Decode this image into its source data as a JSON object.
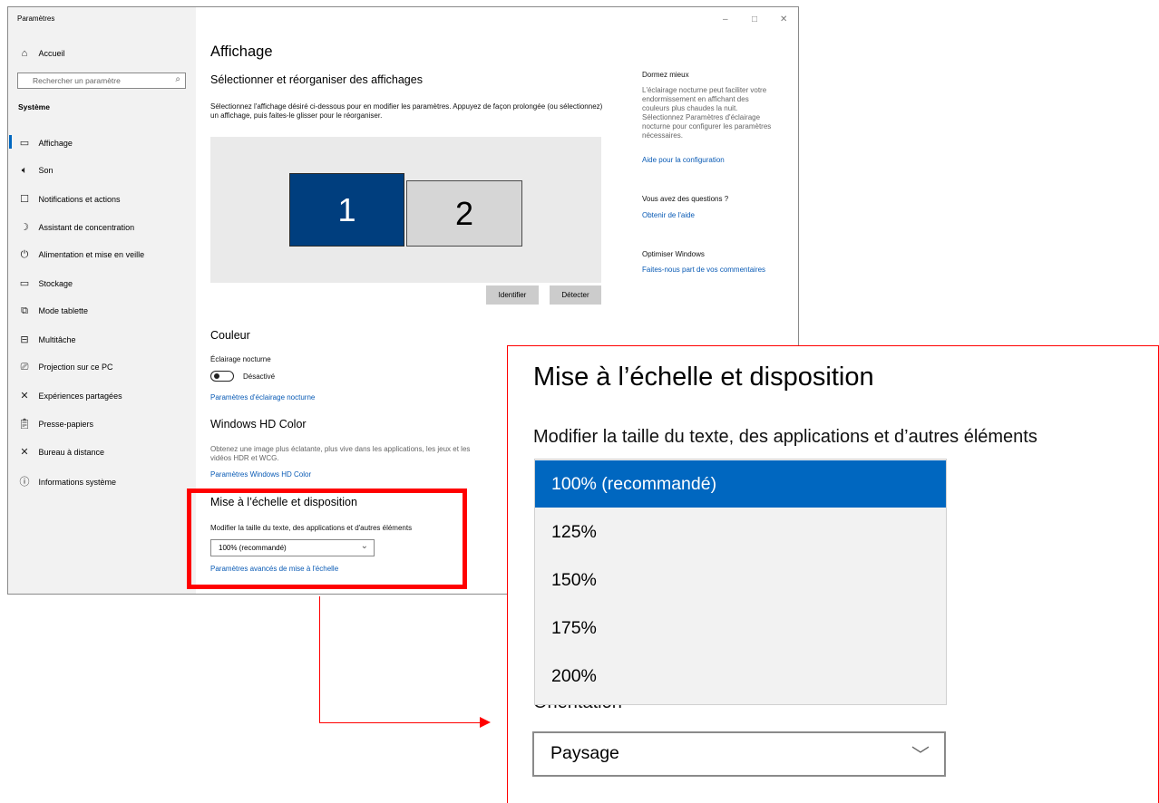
{
  "window": {
    "title": "Paramètres",
    "controls": [
      "–",
      "□",
      "✕"
    ]
  },
  "sidebar": {
    "home": "Accueil",
    "search_placeholder": "Rechercher un paramètre",
    "section": "Système",
    "items": [
      {
        "label": "Affichage",
        "icon": "monitor-icon"
      },
      {
        "label": "Son",
        "icon": "speaker-icon"
      },
      {
        "label": "Notifications et actions",
        "icon": "notification-icon"
      },
      {
        "label": "Assistant de concentration",
        "icon": "moon-icon"
      },
      {
        "label": "Alimentation et mise en veille",
        "icon": "power-icon"
      },
      {
        "label": "Stockage",
        "icon": "storage-icon"
      },
      {
        "label": "Mode tablette",
        "icon": "tablet-icon"
      },
      {
        "label": "Multitâche",
        "icon": "multitask-icon"
      },
      {
        "label": "Projection sur ce PC",
        "icon": "projection-icon"
      },
      {
        "label": "Expériences partagées",
        "icon": "shared-icon"
      },
      {
        "label": "Presse-papiers",
        "icon": "clipboard-icon"
      },
      {
        "label": "Bureau à distance",
        "icon": "remote-desktop-icon"
      },
      {
        "label": "Informations système",
        "icon": "info-icon"
      }
    ]
  },
  "main": {
    "title": "Affichage",
    "arrange_heading": "Sélectionner et réorganiser des affichages",
    "arrange_desc": "Sélectionnez l'affichage désiré ci-dessous pour en modifier les paramètres. Appuyez de façon prolongée (ou sélectionnez) un affichage, puis faites-le glisser pour le réorganiser.",
    "monitors": [
      "1",
      "2"
    ],
    "identify": "Identifier",
    "detect": "Détecter",
    "color_heading": "Couleur",
    "night_light_label": "Éclairage nocturne",
    "night_light_state": "Désactivé",
    "night_light_link": "Paramètres d'éclairage nocturne",
    "hdr_heading": "Windows HD Color",
    "hdr_desc": "Obtenez une image plus éclatante, plus vive dans les applications, les jeux et les vidéos HDR et WCG.",
    "hdr_link": "Paramètres Windows HD Color",
    "scale_heading": "Mise à l’échelle et disposition",
    "scale_label": "Modifier la taille du texte, des applications et d'autres éléments",
    "scale_value": "100% (recommandé)",
    "scale_link": "Paramètres avancés de mise à l'échelle"
  },
  "aside": {
    "sleep_heading": "Dormez mieux",
    "sleep_text": "L'éclairage nocturne peut faciliter votre endormissement en affichant des couleurs plus chaudes la nuit. Sélectionnez Paramètres d'éclairage nocturne pour configurer les paramètres nécessaires.",
    "sleep_link": "Aide pour la configuration",
    "questions_heading": "Vous avez des questions ?",
    "questions_link": "Obtenir de l'aide",
    "optimize_heading": "Optimiser Windows",
    "optimize_link": "Faites-nous part de vos commentaires"
  },
  "zoom": {
    "heading": "Mise à l’échelle et disposition",
    "label": "Modifier la taille du texte, des applications et d’autres éléments",
    "options": [
      "100% (recommandé)",
      "125%",
      "150%",
      "175%",
      "200%"
    ],
    "selected_index": 0,
    "orientation_label": "Orientation",
    "orientation_value": "Paysage"
  },
  "colors": {
    "accent": "#0067c0",
    "monitor_selected": "#003e7e",
    "highlight": "#ff0000",
    "link": "#0a5bb5"
  }
}
